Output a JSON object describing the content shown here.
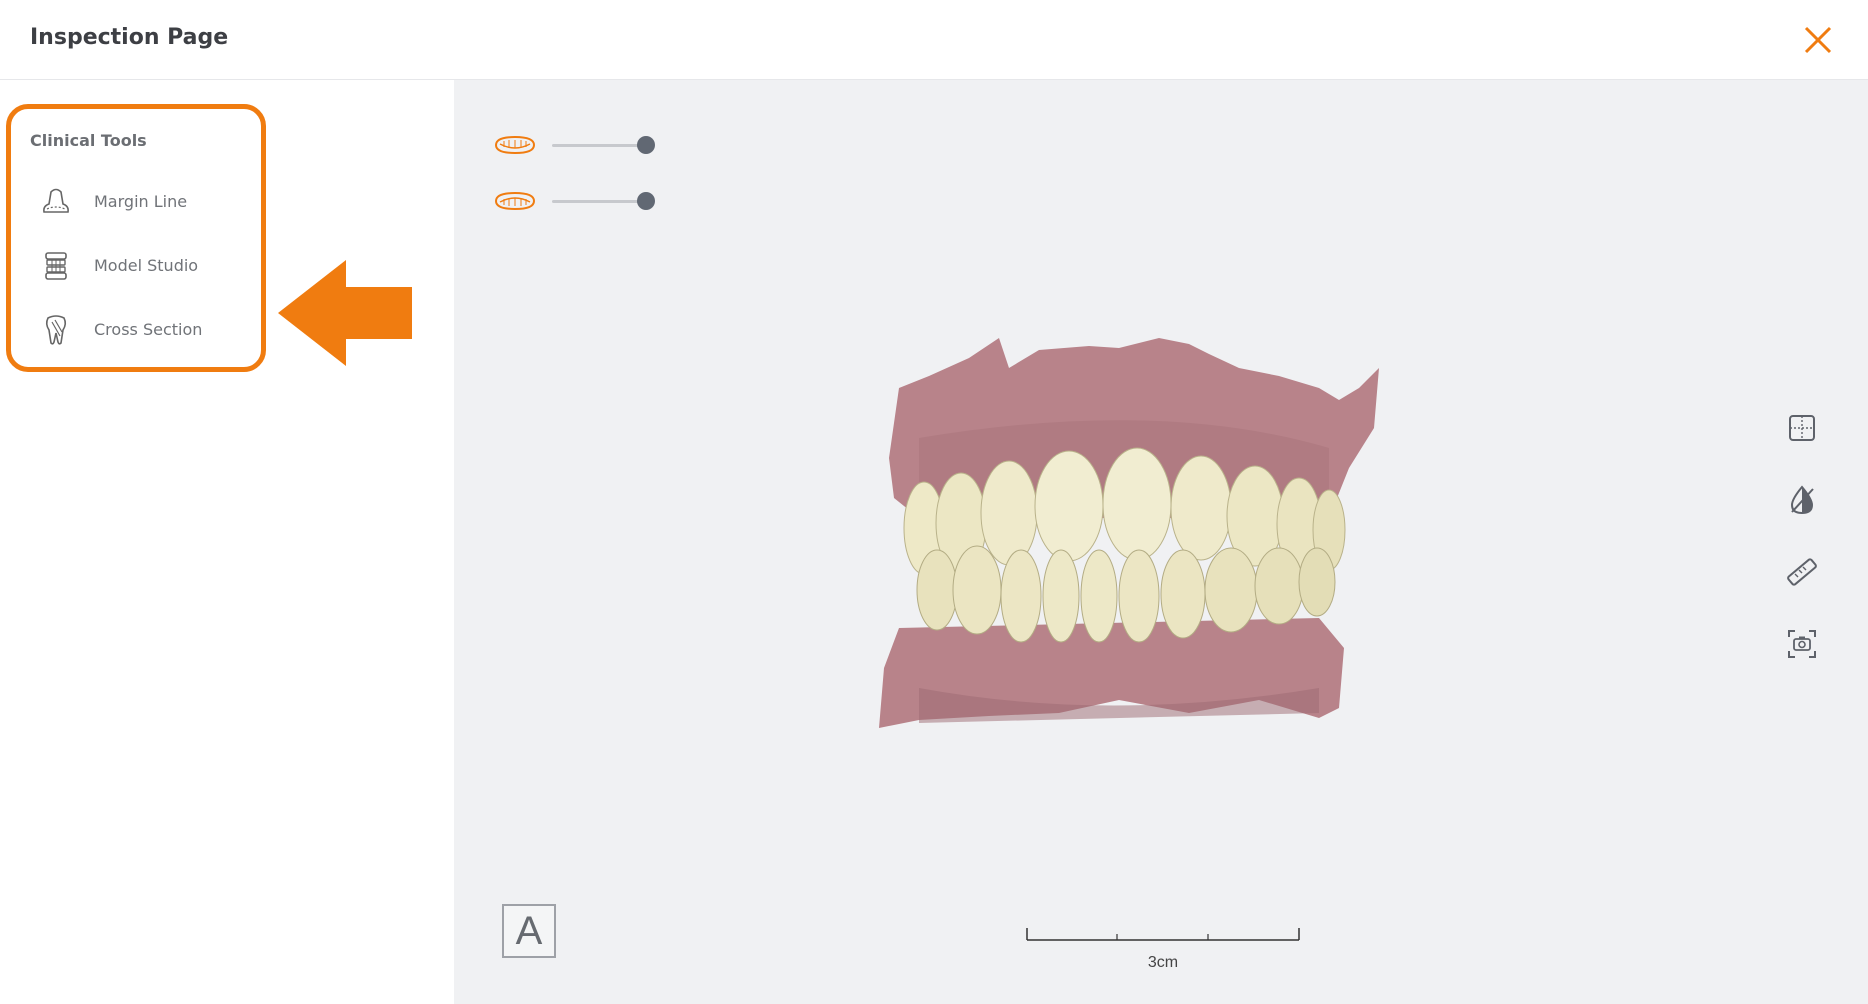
{
  "header": {
    "title": "Inspection Page",
    "close_icon": "close-icon",
    "accent_color": "#f07c10"
  },
  "sidebar": {
    "heading": "Clinical Tools",
    "items": [
      {
        "label": "Margin Line",
        "icon": "margin-line-icon"
      },
      {
        "label": "Model Studio",
        "icon": "model-studio-icon"
      },
      {
        "label": "Cross Section",
        "icon": "tooth-cross-section-icon"
      }
    ],
    "highlight_color": "#f07c10"
  },
  "viewport": {
    "sliders": [
      {
        "icon": "upper-jaw-icon",
        "value": 1.0
      },
      {
        "icon": "lower-jaw-icon",
        "value": 1.0
      }
    ],
    "right_tools": [
      "split-view-icon",
      "color-toggle-icon",
      "ruler-icon",
      "screenshot-icon"
    ],
    "view_button_label": "A",
    "scale_label": "3cm",
    "background_color": "#f0f1f3"
  }
}
